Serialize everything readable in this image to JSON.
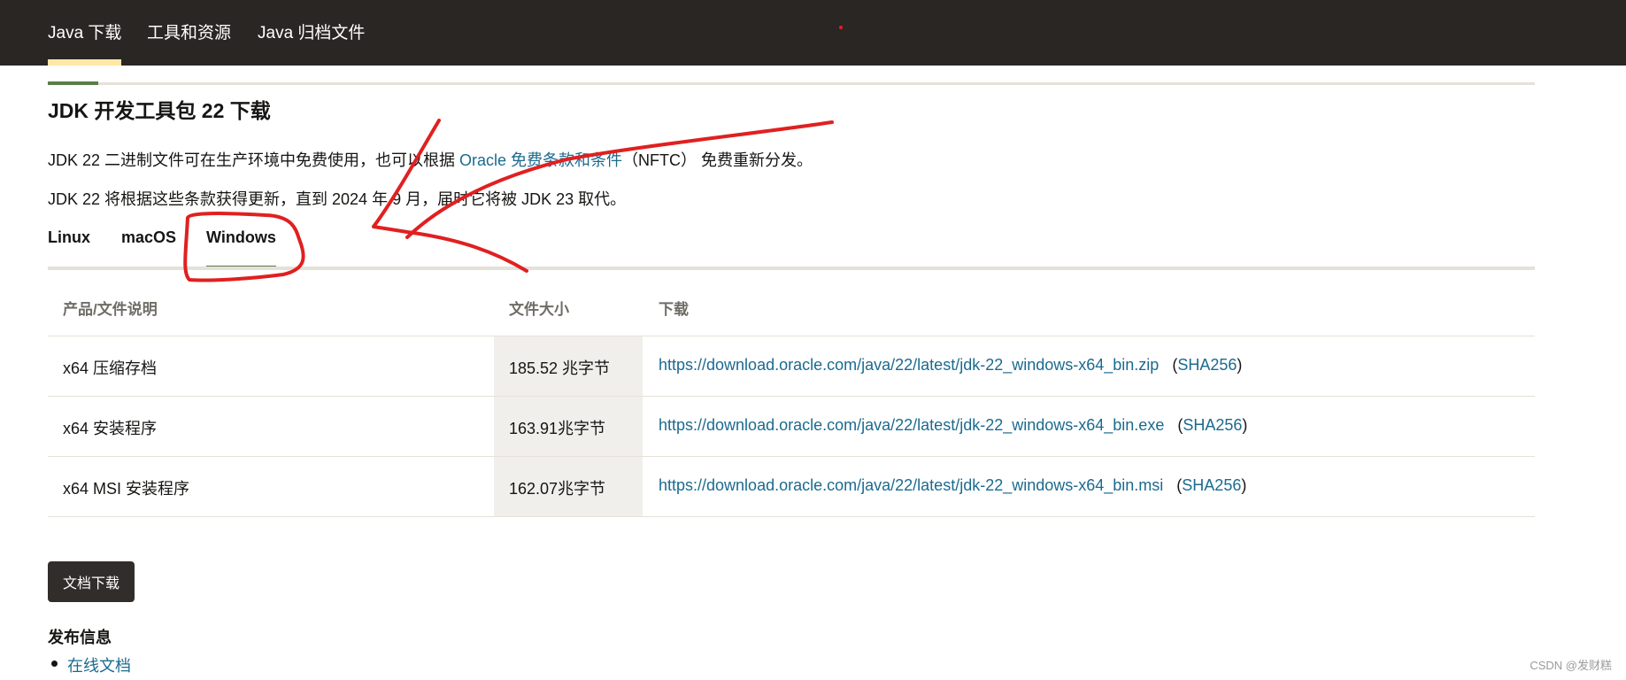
{
  "topnav": {
    "items": [
      {
        "label": "Java 下载",
        "active": true
      },
      {
        "label": "工具和资源",
        "active": false
      },
      {
        "label": "Java 归档文件",
        "active": false
      }
    ],
    "background": "#2a2624",
    "active_underline_color": "#ffe7a8"
  },
  "page_title": "JDK 开发工具包 22 下载",
  "intro": {
    "line1_prefix": "JDK 22 二进制文件可在生产环境中免费使用，也可以根据 ",
    "line1_link": "Oracle 免费条款和条件",
    "line1_suffix": "（NFTC） 免费重新分发。",
    "line2": "JDK 22 将根据这些条款获得更新，直到 2024 年 9 月，届时它将被 JDK 23 取代。"
  },
  "os_tabs": [
    {
      "label": "Linux",
      "active": false
    },
    {
      "label": "macOS",
      "active": false
    },
    {
      "label": "Windows",
      "active": true
    }
  ],
  "table": {
    "headers": [
      "产品/文件说明",
      "文件大小",
      "下载"
    ],
    "rows": [
      {
        "product": "x64 压缩存档",
        "size": "185.52 兆字节",
        "url": "https://download.oracle.com/java/22/latest/jdk-22_windows-x64_bin.zip",
        "sha": "SHA256"
      },
      {
        "product": "x64 安装程序",
        "size": "163.91兆字节",
        "url": "https://download.oracle.com/java/22/latest/jdk-22_windows-x64_bin.exe",
        "sha": "SHA256"
      },
      {
        "product": "x64 MSI 安装程序",
        "size": "162.07兆字节",
        "url": "https://download.oracle.com/java/22/latest/jdk-22_windows-x64_bin.msi",
        "sha": "SHA256"
      }
    ]
  },
  "doc_download_button": "文档下载",
  "release_info": {
    "heading": "发布信息",
    "items": [
      "在线文档"
    ]
  },
  "watermark": "CSDN @发财糕",
  "colors": {
    "link": "#1b6a8f",
    "accent_green": "#5b7d4a",
    "annotation_red": "#e02020"
  },
  "icons": [
    "red-annotation-arrow-icon",
    "red-annotation-circle-icon"
  ]
}
